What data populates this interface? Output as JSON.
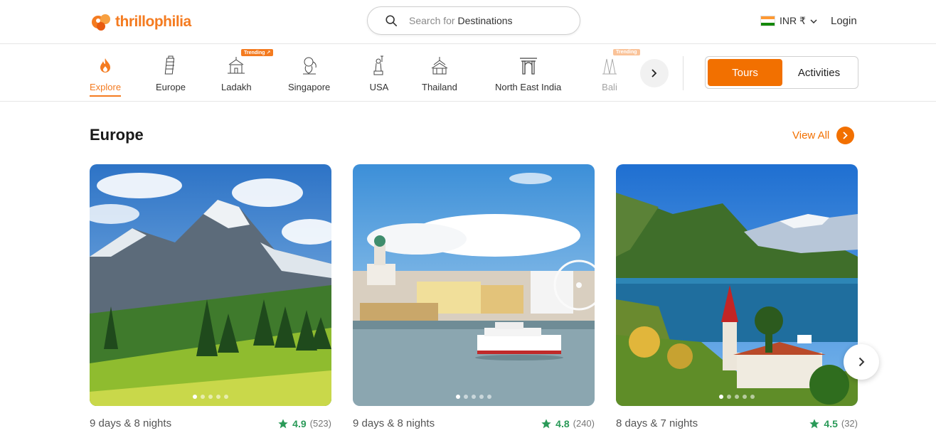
{
  "header": {
    "logo_text": "thrillophilia",
    "search": {
      "prefix": "Search for",
      "term": "Destinations"
    },
    "currency": "INR ₹",
    "login_label": "Login"
  },
  "nav": {
    "items": [
      {
        "label": "Explore",
        "icon": "flame-icon",
        "active": true
      },
      {
        "label": "Europe",
        "icon": "leaning-tower-icon"
      },
      {
        "label": "Ladakh",
        "icon": "monastery-icon",
        "badge": "Trending ↗"
      },
      {
        "label": "Singapore",
        "icon": "merlion-icon"
      },
      {
        "label": "USA",
        "icon": "statue-of-liberty-icon"
      },
      {
        "label": "Thailand",
        "icon": "temple-icon"
      },
      {
        "label": "North East India",
        "icon": "gate-icon"
      },
      {
        "label": "Bali",
        "icon": "bali-temple-icon",
        "badge": "Trending"
      }
    ],
    "toggle": {
      "tours": "Tours",
      "activities": "Activities"
    }
  },
  "section": {
    "title": "Europe",
    "view_all": "View All"
  },
  "cards": [
    {
      "duration": "9 days & 8 nights",
      "rating": "4.9",
      "reviews": "(523)",
      "image": "mountain-landscape"
    },
    {
      "duration": "9 days & 8 nights",
      "rating": "4.8",
      "reviews": "(240)",
      "image": "helsinki-harbour"
    },
    {
      "duration": "8 days & 7 nights",
      "rating": "4.5",
      "reviews": "(32)",
      "image": "swiss-lake-church"
    }
  ],
  "colors": {
    "accent": "#f27000",
    "rating_green": "#2a9a58"
  }
}
